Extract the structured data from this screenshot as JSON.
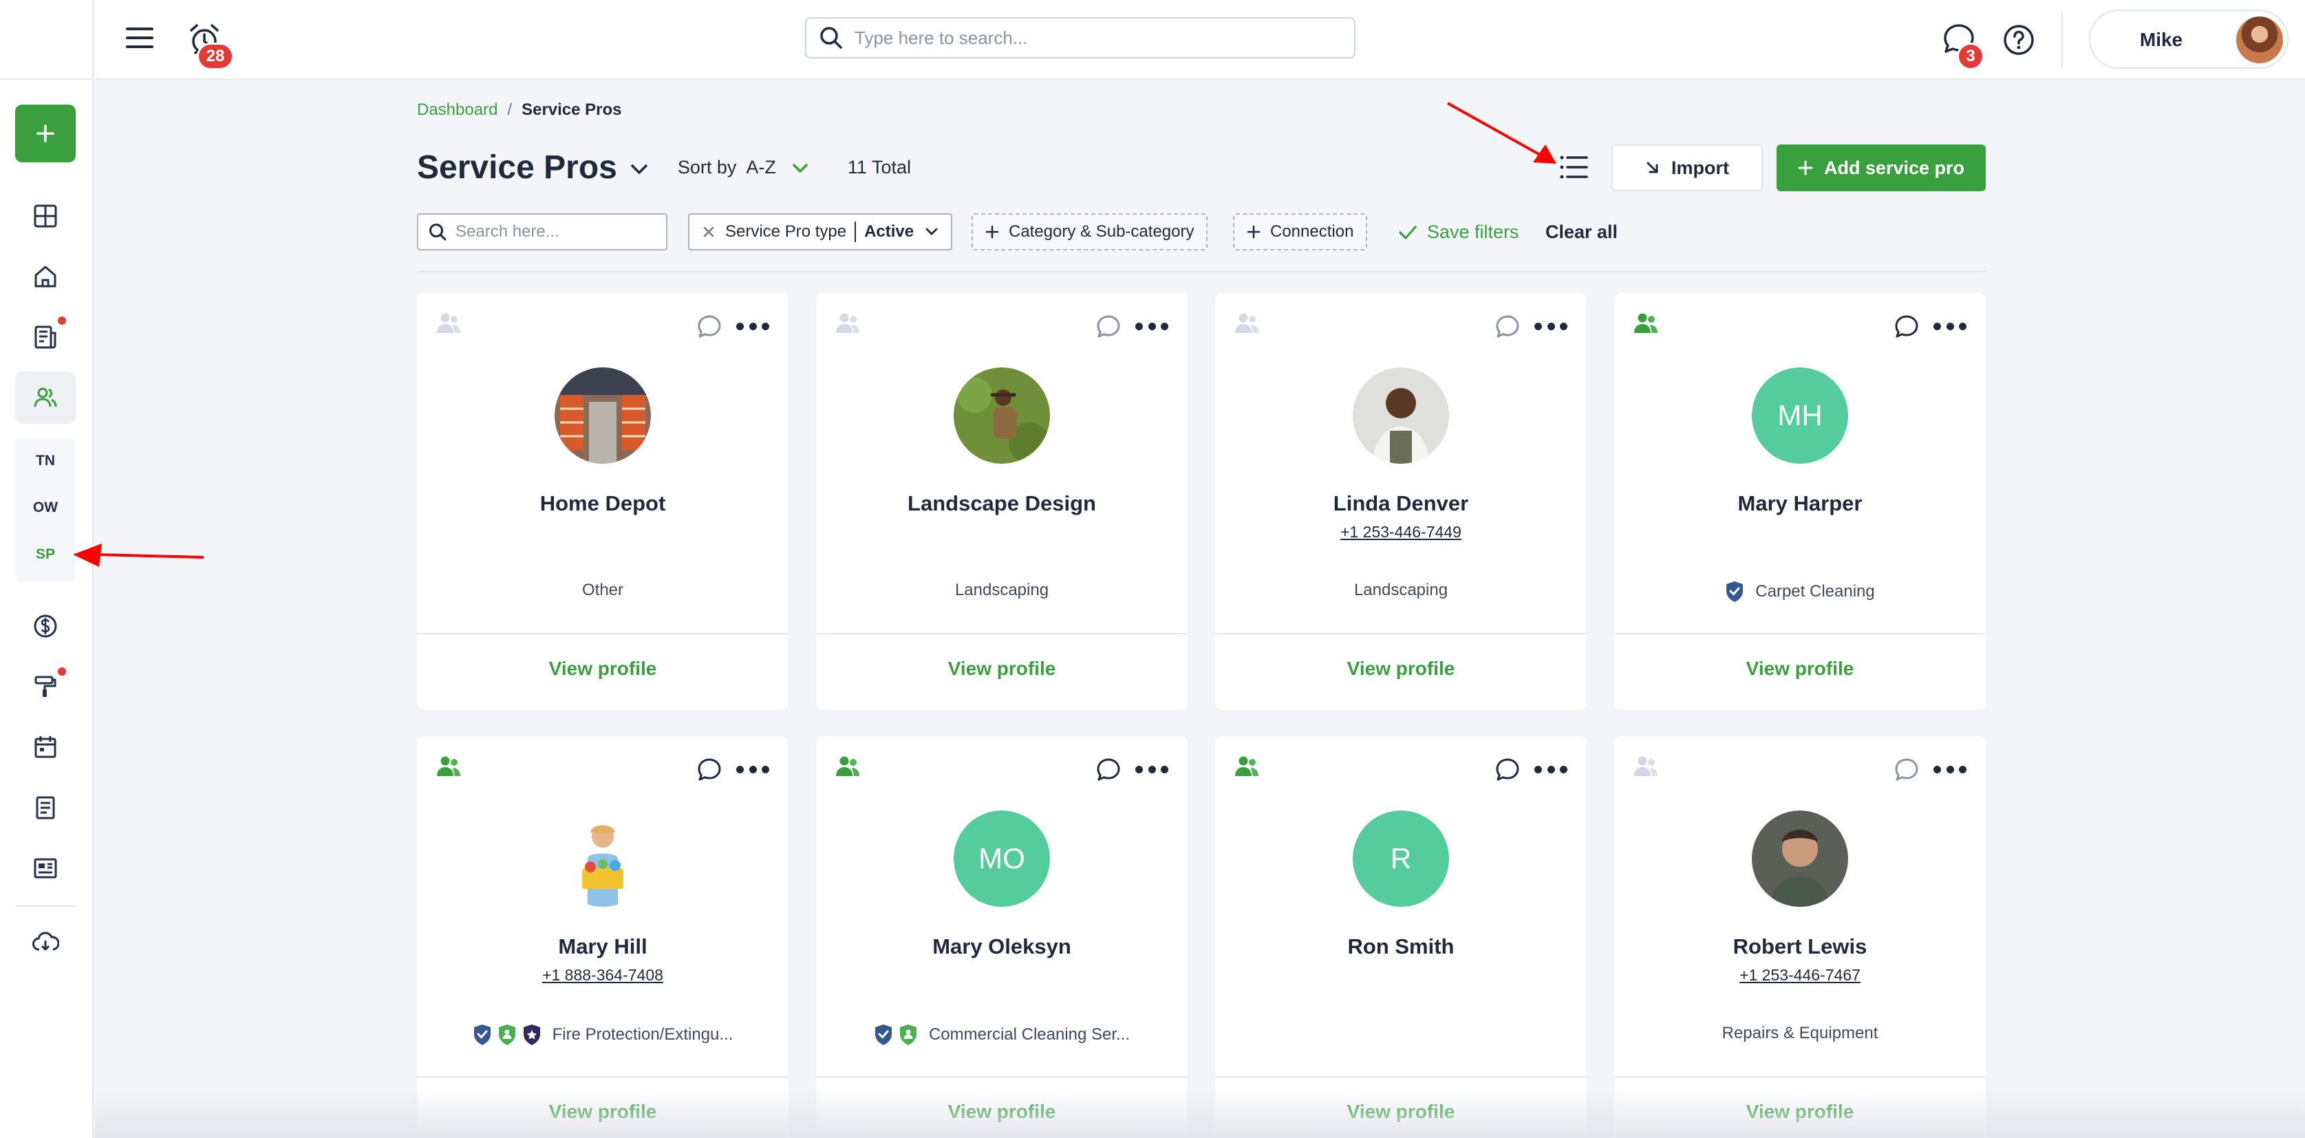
{
  "topbar": {
    "alarm_badge": "28",
    "search_placeholder": "Type here to search...",
    "messages_badge": "3",
    "user_name": "Mike"
  },
  "sidebar": {
    "sub_items": [
      "TN",
      "OW",
      "SP"
    ],
    "active_sub_item": "SP"
  },
  "breadcrumb": {
    "root": "Dashboard",
    "separator": "/",
    "current": "Service Pros"
  },
  "header": {
    "title": "Service Pros",
    "sort_label": "Sort by",
    "sort_value": "A-Z",
    "total": "11 Total",
    "import_label": "Import",
    "add_label": "Add service pro"
  },
  "filters": {
    "search_placeholder": "Search here...",
    "type_chip_label": "Service Pro type",
    "type_chip_value": "Active",
    "category_chip": "Category & Sub-category",
    "connection_chip": "Connection",
    "save_filters": "Save filters",
    "clear_all": "Clear all"
  },
  "cards": [
    {
      "name": "Home Depot",
      "phone": "",
      "category": "Other",
      "connected": false,
      "avatar": "photo-store",
      "initials": "",
      "badges": [],
      "view": "View profile"
    },
    {
      "name": "Landscape Design",
      "phone": "",
      "category": "Landscaping",
      "connected": false,
      "avatar": "photo-garden",
      "initials": "",
      "badges": [],
      "view": "View profile"
    },
    {
      "name": "Linda Denver",
      "phone": "+1 253-446-7449",
      "category": "Landscaping",
      "connected": false,
      "avatar": "photo-person-apron",
      "initials": "",
      "badges": [],
      "view": "View profile"
    },
    {
      "name": "Mary Harper",
      "phone": "",
      "category": "Carpet Cleaning",
      "connected": true,
      "avatar": "initials",
      "initials": "MH",
      "badges": [
        "blue"
      ],
      "view": "View profile"
    },
    {
      "name": "Mary Hill",
      "phone": "+1 888-364-7408",
      "category": "Fire Protection/Extingu...",
      "connected": true,
      "avatar": "photo-cleaner",
      "initials": "",
      "badges": [
        "blue",
        "green",
        "purple"
      ],
      "view": "View profile"
    },
    {
      "name": "Mary Oleksyn",
      "phone": "",
      "category": "Commercial Cleaning Ser...",
      "connected": true,
      "avatar": "initials",
      "initials": "MO",
      "badges": [
        "blue",
        "green"
      ],
      "view": "View profile"
    },
    {
      "name": "Ron Smith",
      "phone": "",
      "category": "",
      "connected": true,
      "avatar": "initials",
      "initials": "R",
      "badges": [],
      "view": "View profile"
    },
    {
      "name": "Robert Lewis",
      "phone": "+1 253-446-7467",
      "category": "Repairs & Equipment",
      "connected": false,
      "avatar": "photo-man",
      "initials": "",
      "badges": [],
      "view": "View profile"
    }
  ],
  "colors": {
    "brand_green": "#3aa03f",
    "initials_green": "#55cc9d",
    "badge_red": "#e53935",
    "text_dark": "#1f2a3c",
    "shield_blue": "#34588f",
    "shield_green": "#4caf50",
    "shield_purple": "#2f2a5e",
    "annotation_red": "#ff0000"
  }
}
